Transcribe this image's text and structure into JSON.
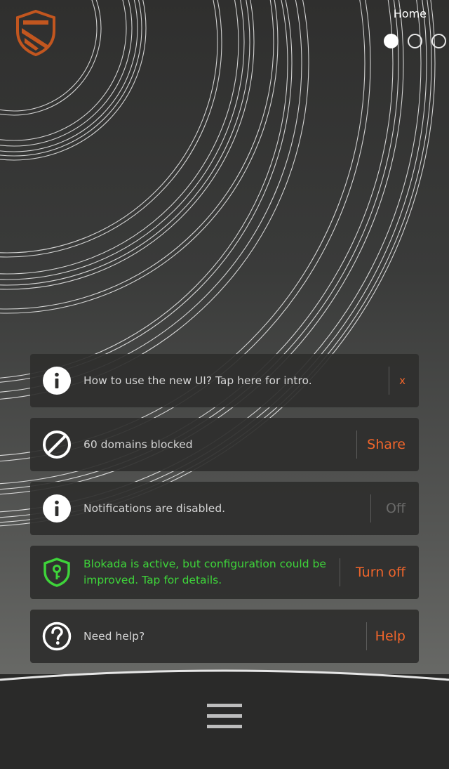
{
  "header": {
    "title": "Home",
    "pager": {
      "count": 3,
      "active_index": 0
    }
  },
  "cards": [
    {
      "icon": "info-icon",
      "message": "How to use the new UI? Tap here for intro.",
      "action": "x"
    },
    {
      "icon": "blocked-icon",
      "message": "60 domains blocked",
      "action": "Share"
    },
    {
      "icon": "info-icon",
      "message": "Notifications are disabled.",
      "action": "Off"
    },
    {
      "icon": "shield-key-icon",
      "message_line1": "Blokada is active, but configuration could be",
      "message_line2": "improved. Tap for details.",
      "action": "Turn off"
    },
    {
      "icon": "help-icon",
      "message": "Need help?",
      "action": "Help"
    }
  ],
  "colors": {
    "accent": "#f0652b",
    "active_status": "#3ed43a",
    "muted": "#6b6b6a",
    "logo": "#c2561f",
    "card_bg": "#2e2e2d",
    "bottom_bar": "#2a2a29"
  },
  "nav": {
    "icon": "hamburger-menu-icon"
  }
}
